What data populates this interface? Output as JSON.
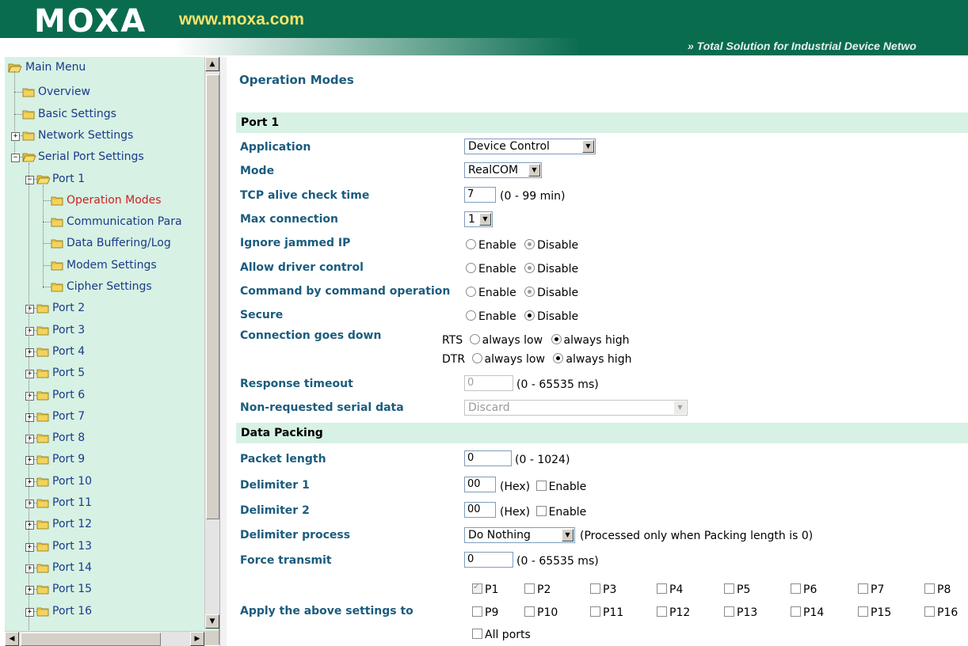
{
  "header": {
    "logo_text": "MOXA",
    "site_url": "www.moxa.com",
    "tagline": "» Total Solution for Industrial Device Netwo"
  },
  "sidebar": {
    "root": "Main Menu",
    "items": [
      {
        "label": "Overview"
      },
      {
        "label": "Basic Settings"
      },
      {
        "label": "Network Settings"
      },
      {
        "label": "Serial Port Settings"
      },
      {
        "label": "Port 1"
      },
      {
        "label": "Operation Modes"
      },
      {
        "label": "Communication Para"
      },
      {
        "label": "Data Buffering/Log"
      },
      {
        "label": "Modem Settings"
      },
      {
        "label": "Cipher Settings"
      },
      {
        "label": "Port 2"
      },
      {
        "label": "Port 3"
      },
      {
        "label": "Port 4"
      },
      {
        "label": "Port 5"
      },
      {
        "label": "Port 6"
      },
      {
        "label": "Port 7"
      },
      {
        "label": "Port 8"
      },
      {
        "label": "Port 9"
      },
      {
        "label": "Port 10"
      },
      {
        "label": "Port 11"
      },
      {
        "label": "Port 12"
      },
      {
        "label": "Port 13"
      },
      {
        "label": "Port 14"
      },
      {
        "label": "Port 15"
      },
      {
        "label": "Port 16"
      }
    ],
    "selected": "Operation Modes",
    "selected_color": "#cc2222",
    "link_color": "#1a3b8a"
  },
  "main": {
    "title": "Operation Modes",
    "section_port": "Port 1",
    "section_packing": "Data Packing",
    "fields": {
      "application": {
        "label": "Application",
        "value": "Device Control"
      },
      "mode": {
        "label": "Mode",
        "value": "RealCOM"
      },
      "tcp_alive": {
        "label": "TCP alive check time",
        "value": "7",
        "hint": "(0 - 99 min)"
      },
      "max_conn": {
        "label": "Max connection",
        "value": "1"
      },
      "ignore_jammed": {
        "label": "Ignore jammed IP"
      },
      "allow_driver": {
        "label": "Allow driver control"
      },
      "cmd_by_cmd": {
        "label": "Command by command operation"
      },
      "secure": {
        "label": "Secure"
      },
      "conn_down": {
        "label": "Connection goes down",
        "rts": "RTS",
        "dtr": "DTR",
        "low": "always low",
        "high": "always high"
      },
      "resp_timeout": {
        "label": "Response timeout",
        "value": "0",
        "hint": "(0 - 65535 ms)"
      },
      "non_requested": {
        "label": "Non-requested serial data",
        "value": "Discard"
      },
      "packet_len": {
        "label": "Packet length",
        "value": "0",
        "hint": "(0 - 1024)"
      },
      "delim1": {
        "label": "Delimiter 1",
        "value": "00",
        "hex": "(Hex)",
        "enable": "Enable"
      },
      "delim2": {
        "label": "Delimiter 2",
        "value": "00",
        "hex": "(Hex)",
        "enable": "Enable"
      },
      "delim_proc": {
        "label": "Delimiter process",
        "value": "Do Nothing",
        "hint": "(Processed only when Packing length is 0)"
      },
      "force_tx": {
        "label": "Force transmit",
        "value": "0",
        "hint": "(0 - 65535 ms)"
      },
      "apply": {
        "label": "Apply the above settings to",
        "all_ports": "All ports"
      }
    },
    "enable": "Enable",
    "disable": "Disable",
    "ports_row1": [
      "P1",
      "P2",
      "P3",
      "P4",
      "P5",
      "P6",
      "P7",
      "P8"
    ],
    "ports_row2": [
      "P9",
      "P10",
      "P11",
      "P12",
      "P13",
      "P14",
      "P15",
      "P16"
    ]
  }
}
